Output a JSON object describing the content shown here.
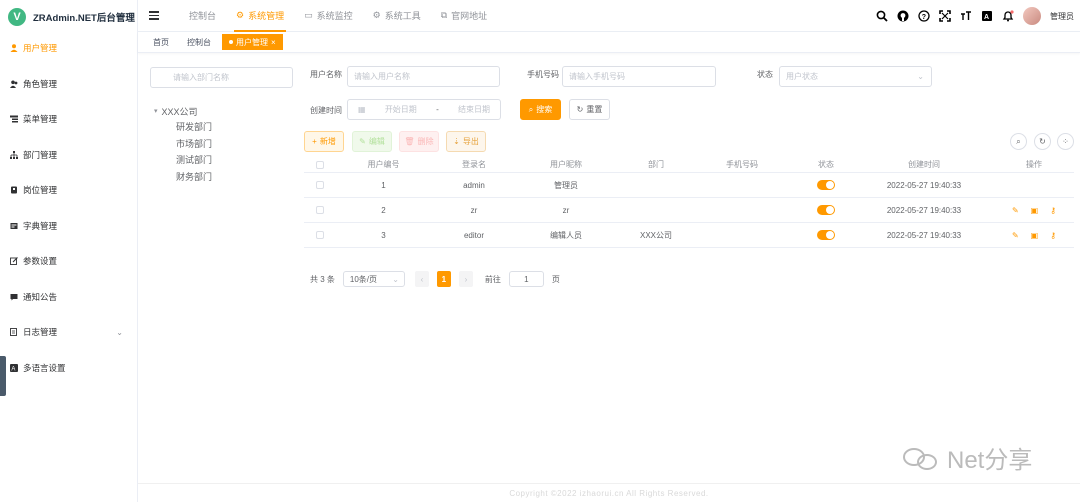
{
  "app": {
    "logo_letter": "V",
    "title": "ZRAdmin.NET后台管理"
  },
  "sidebar": {
    "items": [
      {
        "label": "用户管理",
        "icon": "user-icon",
        "active": true
      },
      {
        "label": "角色管理",
        "icon": "peoples-icon"
      },
      {
        "label": "菜单管理",
        "icon": "tree-table-icon"
      },
      {
        "label": "部门管理",
        "icon": "tree-icon"
      },
      {
        "label": "岗位管理",
        "icon": "post-icon"
      },
      {
        "label": "字典管理",
        "icon": "dict-icon"
      },
      {
        "label": "参数设置",
        "icon": "edit-icon"
      },
      {
        "label": "通知公告",
        "icon": "message-icon"
      },
      {
        "label": "日志管理",
        "icon": "log-icon",
        "has_children": true
      },
      {
        "label": "多语言设置",
        "icon": "language-icon"
      }
    ]
  },
  "header": {
    "nav": [
      {
        "label": "控制台"
      },
      {
        "label": "系统管理",
        "active": true
      },
      {
        "label": "系统监控"
      },
      {
        "label": "系统工具"
      },
      {
        "label": "官网地址"
      }
    ],
    "username": "管理员"
  },
  "tags": [
    {
      "label": "首页"
    },
    {
      "label": "控制台"
    },
    {
      "label": "用户管理",
      "active": true
    }
  ],
  "dept": {
    "search_placeholder": "请输入部门名称",
    "root": "XXX公司",
    "children": [
      "研发部门",
      "市场部门",
      "测试部门",
      "财务部门"
    ]
  },
  "query": {
    "username_label": "用户名称",
    "username_placeholder": "请输入用户名称",
    "phone_label": "手机号码",
    "phone_placeholder": "请输入手机号码",
    "status_label": "状态",
    "status_placeholder": "用户状态",
    "time_label": "创建时间",
    "start_placeholder": "开始日期",
    "range_sep": "-",
    "end_placeholder": "结束日期",
    "search_btn": "搜索",
    "reset_btn": "重置"
  },
  "toolbar": {
    "add": "新增",
    "edit": "编辑",
    "delete": "删除",
    "export": "导出"
  },
  "table": {
    "headers": [
      "用户编号",
      "登录名",
      "用户昵称",
      "部门",
      "手机号码",
      "状态",
      "创建时间",
      "操作"
    ],
    "rows": [
      {
        "id": "1",
        "login": "admin",
        "nick": "管理员",
        "dept": "",
        "phone": "",
        "status": true,
        "created": "2022-05-27 19:40:33",
        "ops": false
      },
      {
        "id": "2",
        "login": "zr",
        "nick": "zr",
        "dept": "",
        "phone": "",
        "status": true,
        "created": "2022-05-27 19:40:33",
        "ops": true
      },
      {
        "id": "3",
        "login": "editor",
        "nick": "编辑人员",
        "dept": "XXX公司",
        "phone": "",
        "status": true,
        "created": "2022-05-27 19:40:33",
        "ops": true
      }
    ]
  },
  "pager": {
    "total": "共 3 条",
    "size": "10条/页",
    "current": "1",
    "goto": "前往",
    "goto_value": "1",
    "page_unit": "页"
  },
  "footer": "Copyright ©2022 izhaorui.cn All Rights Reserved.",
  "watermark": "Net分享",
  "colors": {
    "accent": "#ff9900",
    "logo": "#41b883"
  }
}
